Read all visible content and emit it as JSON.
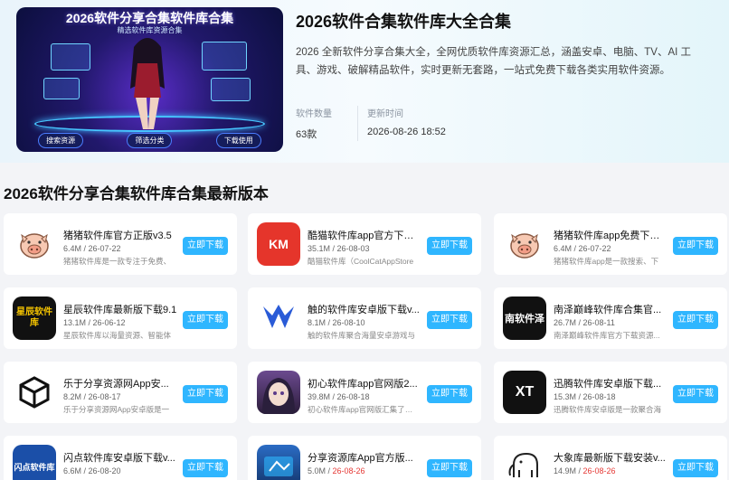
{
  "hero": {
    "banner_title": "2026软件分享合集软件库合集",
    "banner_subtitle": "精选软件库资源合集",
    "banner_chips": [
      "搜索资源",
      "筛选分类",
      "下载使用"
    ],
    "title": "2026软件合集软件库大全合集",
    "description": "2026 全新软件分享合集大全，全网优质软件库资源汇总，涵盖安卓、电脑、TV、AI 工具、游戏、破解精品软件，实时更新无套路，一站式免费下载各类实用软件资源。",
    "stats": [
      {
        "label": "软件数量",
        "value": "63款"
      },
      {
        "label": "更新时间",
        "value": "2026-08-26 18:52"
      }
    ]
  },
  "section": {
    "title": "2026软件分享合集软件库合集最新版本"
  },
  "download_label": "立即下载",
  "apps": [
    {
      "name": "猪猪软件库官方正版v3.5",
      "size": "6.4M",
      "date": "26-07-22",
      "desc": "猪猪软件库是一款专注于免费、",
      "icon": "pig-icon",
      "icon_text": ""
    },
    {
      "name": "酷猫软件库app官方下载...",
      "size": "35.1M",
      "date": "26-08-03",
      "desc": "酷猫软件库（CoolCatAppStore",
      "icon": "km-icon",
      "icon_text": "KM"
    },
    {
      "name": "猪猪软件库app免费下载...",
      "size": "6.4M",
      "date": "26-07-22",
      "desc": "猪猪软件库app是一款搜索、下",
      "icon": "pig-icon",
      "icon_text": ""
    },
    {
      "name": "星辰软件库最新版下载9.1",
      "size": "13.1M",
      "date": "26-06-12",
      "desc": "星辰软件库以海量资源、智能体",
      "icon": "star-library-icon",
      "icon_text": "星辰软件库"
    },
    {
      "name": "触的软件库安卓版下载v...",
      "size": "8.1M",
      "date": "26-08-10",
      "desc": "触的软件库聚合海量安卓游戏与",
      "icon": "crown-v-icon",
      "icon_text": ""
    },
    {
      "name": "南泽巅峰软件库合集官...",
      "size": "26.7M",
      "date": "26-08-11",
      "desc": "南泽巅峰软件库官方下载资源...",
      "icon": "nanze-icon",
      "icon_text": "南软件泽"
    },
    {
      "name": "乐于分享资源网App安...",
      "size": "8.2M",
      "date": "26-08-17",
      "desc": "乐于分享资源网App安卓版是一",
      "icon": "cube-icon",
      "icon_text": ""
    },
    {
      "name": "初心软件库app官网版2...",
      "size": "39.8M",
      "date": "26-08-18",
      "desc": "初心软件库app官网版汇集了众多",
      "icon": "anime-avatar-icon",
      "icon_text": ""
    },
    {
      "name": "迅腾软件库安卓版下载...",
      "size": "15.3M",
      "date": "26-08-18",
      "desc": "迅腾软件库安卓版是一款聚合海",
      "icon": "xt-icon",
      "icon_text": "XT"
    },
    {
      "name": "闪点软件库安卓版下载v...",
      "size": "6.6M",
      "date": "26-08-20",
      "desc": "",
      "icon": "flash-icon",
      "icon_text": "闪点软件库"
    },
    {
      "name": "分享资源库App官方版...",
      "size": "5.0M",
      "date": "26-08-26",
      "desc": "",
      "icon": "share-library-icon",
      "icon_text": ""
    },
    {
      "name": "大象库最新版下载安装v...",
      "size": "14.9M",
      "date": "26-08-26",
      "desc": "",
      "icon": "elephant-icon",
      "icon_text": ""
    }
  ]
}
